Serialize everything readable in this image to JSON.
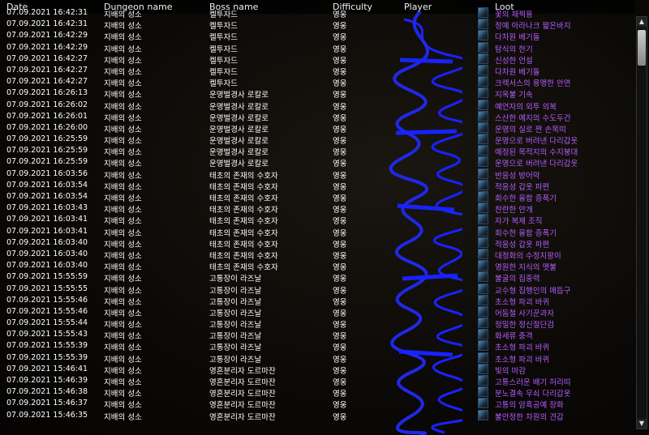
{
  "header": {
    "date": "Date",
    "dungeon": "Dungeon name",
    "boss": "Boss name",
    "difficulty": "Difficulty",
    "player": "Player",
    "loot": "Loot"
  },
  "rows": [
    {
      "date": "07.09.2021 16:42:31",
      "dungeon": "지배의 성소",
      "boss": "켈투자드",
      "difficulty": "영웅",
      "loot": "꽃의 채찍용"
    },
    {
      "date": "07.09.2021 16:42:31",
      "dungeon": "지배의 성소",
      "boss": "켈투자드",
      "difficulty": "영웅",
      "loot": "정예 아라나크 짧은바지"
    },
    {
      "date": "07.09.2021 16:42:29",
      "dungeon": "지배의 성소",
      "boss": "켈투자드",
      "difficulty": "영웅",
      "loot": "다차원 베기돌"
    },
    {
      "date": "07.09.2021 16:42:29",
      "dungeon": "지배의 성소",
      "boss": "켈투자드",
      "difficulty": "영웅",
      "loot": "탐식의 한기"
    },
    {
      "date": "07.09.2021 16:42:27",
      "dungeon": "지배의 성소",
      "boss": "켈투자드",
      "difficulty": "영웅",
      "loot": "신성한 언설"
    },
    {
      "date": "07.09.2021 16:42:27",
      "dungeon": "지배의 성소",
      "boss": "켈투자드",
      "difficulty": "영웅",
      "loot": "다차원 베기돌"
    },
    {
      "date": "07.09.2021 16:42:27",
      "dungeon": "지배의 성소",
      "boss": "켈투자드",
      "difficulty": "영웅",
      "loot": "크렉서스의 용맹한 안면"
    },
    {
      "date": "07.09.2021 16:26:13",
      "dungeon": "지배의 성소",
      "boss": "운명벌경사 로칼로",
      "difficulty": "영웅",
      "loot": "지옥불 기속"
    },
    {
      "date": "07.09.2021 16:26:02",
      "dungeon": "지배의 성소",
      "boss": "운명벌경사 로칼로",
      "difficulty": "영웅",
      "loot": "예언자의 외투 의복"
    },
    {
      "date": "07.09.2021 16:26:01",
      "dungeon": "지배의 성소",
      "boss": "운명벌경사 로칼로",
      "difficulty": "영웅",
      "loot": "스산한 예지의 수도두건"
    },
    {
      "date": "07.09.2021 16:26:00",
      "dungeon": "지배의 성소",
      "boss": "운명벌경사 로칼로",
      "difficulty": "영웅",
      "loot": "운명의 실로 짠 손목띠"
    },
    {
      "date": "07.09.2021 16:25:59",
      "dungeon": "지배의 성소",
      "boss": "운명벌경사 로칼로",
      "difficulty": "영웅",
      "loot": "운명으로 버려낸 다리갑옷"
    },
    {
      "date": "07.09.2021 16:25:59",
      "dungeon": "지배의 성소",
      "boss": "운명벌경사 로칼로",
      "difficulty": "영웅",
      "loot": "예정된 목적지의 수지붕대"
    },
    {
      "date": "07.09.2021 16:25:59",
      "dungeon": "지배의 성소",
      "boss": "운명벌경사 로칼로",
      "difficulty": "영웅",
      "loot": "운명으로 버려낸 다리갑옷"
    },
    {
      "date": "07.09.2021 16:03:56",
      "dungeon": "지배의 성소",
      "boss": "태초의 존재의 수호자",
      "difficulty": "영웅",
      "loot": "반응성 방어막"
    },
    {
      "date": "07.09.2021 16:03:54",
      "dungeon": "지배의 성소",
      "boss": "태초의 존재의 수호자",
      "difficulty": "영웅",
      "loot": "적응성 갑옷 파편"
    },
    {
      "date": "07.09.2021 16:03:54",
      "dungeon": "지배의 성소",
      "boss": "태초의 존재의 수호자",
      "difficulty": "영웅",
      "loot": "회수한 융합 증폭기"
    },
    {
      "date": "07.09.2021 16:03:43",
      "dungeon": "지배의 성소",
      "boss": "태초의 존재의 수호자",
      "difficulty": "영웅",
      "loot": "찬란한 안개"
    },
    {
      "date": "07.09.2021 16:03:41",
      "dungeon": "지배의 성소",
      "boss": "태초의 존재의 수호자",
      "difficulty": "영웅",
      "loot": "자가 복제 조직"
    },
    {
      "date": "07.09.2021 16:03:41",
      "dungeon": "지배의 성소",
      "boss": "태초의 존재의 수호자",
      "difficulty": "영웅",
      "loot": "회수한 융합 증폭기"
    },
    {
      "date": "07.09.2021 16:03:40",
      "dungeon": "지배의 성소",
      "boss": "태초의 존재의 수호자",
      "difficulty": "영웅",
      "loot": "적응성 갑옷 파편"
    },
    {
      "date": "07.09.2021 16:03:40",
      "dungeon": "지배의 성소",
      "boss": "태초의 존재의 수호자",
      "difficulty": "영웅",
      "loot": "대정화의 수정지팡이"
    },
    {
      "date": "07.09.2021 16:03:40",
      "dungeon": "지배의 성소",
      "boss": "태초의 존재의 수호자",
      "difficulty": "영웅",
      "loot": "영원한 지식의 맷불"
    },
    {
      "date": "07.09.2021 15:55:59",
      "dungeon": "지배의 성소",
      "boss": "고통장이 라즈날",
      "difficulty": "영웅",
      "loot": "불굴의 집중력"
    },
    {
      "date": "07.09.2021 15:55:55",
      "dungeon": "지배의 성소",
      "boss": "고통장이 라즈날",
      "difficulty": "영웅",
      "loot": "교수형 집행인의 매듭구"
    },
    {
      "date": "07.09.2021 15:55:46",
      "dungeon": "지배의 성소",
      "boss": "고통장이 라즈날",
      "difficulty": "영웅",
      "loot": "초소형 파괴 바퀴"
    },
    {
      "date": "07.09.2021 15:55:46",
      "dungeon": "지배의 성소",
      "boss": "고통장이 라즈날",
      "difficulty": "영웅",
      "loot": "어둠철 사기꾼과자"
    },
    {
      "date": "07.09.2021 15:55:44",
      "dungeon": "지배의 성소",
      "boss": "고통장이 라즈날",
      "difficulty": "영웅",
      "loot": "정밀한 정신절단검"
    },
    {
      "date": "07.09.2021 15:55:43",
      "dungeon": "지배의 성소",
      "boss": "고통장이 라즈날",
      "difficulty": "영웅",
      "loot": "화세류 충격"
    },
    {
      "date": "07.09.2021 15:55:39",
      "dungeon": "지배의 성소",
      "boss": "고통장이 라즈날",
      "difficulty": "영웅",
      "loot": "초소형 파괴 바퀴"
    },
    {
      "date": "07.09.2021 15:55:39",
      "dungeon": "지배의 성소",
      "boss": "고통장이 라즈날",
      "difficulty": "영웅",
      "loot": "초소형 파괴 바퀴"
    },
    {
      "date": "07.09.2021 15:46:41",
      "dungeon": "지배의 성소",
      "boss": "영혼분리자 도르마잔",
      "difficulty": "영웅",
      "loot": "빛의 마감"
    },
    {
      "date": "07.09.2021 15:46:39",
      "dungeon": "지배의 성소",
      "boss": "영혼분리자 도르마잔",
      "difficulty": "영웅",
      "loot": "고통스러운 배기 허리띠"
    },
    {
      "date": "07.09.2021 15:46:38",
      "dungeon": "지배의 성소",
      "boss": "영혼분리자 도르마잔",
      "difficulty": "영웅",
      "loot": "분노결속 무쇠 다리갑옷"
    },
    {
      "date": "07.09.2021 15:46:37",
      "dungeon": "지배의 성소",
      "boss": "영혼분리자 도르마잔",
      "difficulty": "영웅",
      "loot": "고통의 암흑공예 장화"
    },
    {
      "date": "07.09.2021 15:46:35",
      "dungeon": "지배의 성소",
      "boss": "영혼분리자 도르마잔",
      "difficulty": "영웅",
      "loot": "불안정한 차원의 견갑"
    }
  ],
  "scrollbar": {
    "up": "▲",
    "down": "▼"
  }
}
